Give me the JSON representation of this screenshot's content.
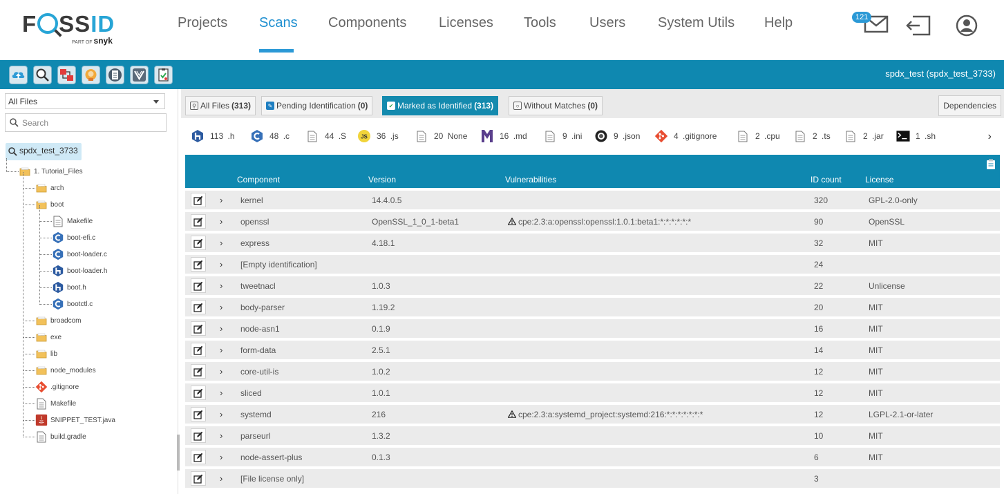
{
  "logo": {
    "word_prefix": "F",
    "word_mid": "SS",
    "word_id": "ID",
    "sub_prefix": "PART OF",
    "sub_brand": "snyk"
  },
  "nav": {
    "items": [
      "Projects",
      "Scans",
      "Components",
      "Licenses",
      "Tools",
      "Users",
      "System Utils",
      "Help"
    ],
    "active": "Scans",
    "mail_badge": "121"
  },
  "toolbar": {
    "scan_title": "spdx_test (spdx_test_3733)",
    "buttons": [
      "upload-icon",
      "search-icon",
      "compare-icon",
      "brain-icon",
      "clipboard-icon",
      "vs-icon",
      "report-icon"
    ]
  },
  "left": {
    "filter_select": "All Files",
    "search_placeholder": "Search",
    "root_label": "spdx_test_3733",
    "tree": [
      {
        "label": "1. Tutorial_Files",
        "type": "folder"
      },
      {
        "label": "arch",
        "type": "folder"
      },
      {
        "label": "boot",
        "type": "folder"
      },
      {
        "label": "Makefile",
        "type": "file"
      },
      {
        "label": "boot-efi.c",
        "type": "c"
      },
      {
        "label": "boot-loader.c",
        "type": "c"
      },
      {
        "label": "boot-loader.h",
        "type": "h"
      },
      {
        "label": "boot.h",
        "type": "h"
      },
      {
        "label": "bootctl.c",
        "type": "c"
      },
      {
        "label": "broadcom",
        "type": "folder"
      },
      {
        "label": "exe",
        "type": "folder"
      },
      {
        "label": "lib",
        "type": "folder"
      },
      {
        "label": "node_modules",
        "type": "folder"
      },
      {
        "label": ".gitignore",
        "type": "git"
      },
      {
        "label": "Makefile",
        "type": "file"
      },
      {
        "label": "SNIPPET_TEST.java",
        "type": "java"
      },
      {
        "label": "build.gradle",
        "type": "file"
      }
    ]
  },
  "filters": [
    {
      "label": "All Files",
      "count": "(313)"
    },
    {
      "label": "Pending Identification",
      "count": "(0)"
    },
    {
      "label": "Marked as Identified",
      "count": "(313)"
    },
    {
      "label": "Without Matches",
      "count": "(0)"
    }
  ],
  "dependencies_label": "Dependencies",
  "extensions": [
    {
      "count": "113",
      "ext": ".h",
      "icon": "h-icon"
    },
    {
      "count": "48",
      "ext": ".c",
      "icon": "c-icon"
    },
    {
      "count": "44",
      "ext": ".S",
      "icon": "file-icon"
    },
    {
      "count": "36",
      "ext": ".js",
      "icon": "js-icon"
    },
    {
      "count": "20",
      "ext": "None",
      "icon": "file-icon"
    },
    {
      "count": "16",
      "ext": ".md",
      "icon": "md-icon"
    },
    {
      "count": "9",
      "ext": ".ini",
      "icon": "file-icon"
    },
    {
      "count": "9",
      "ext": ".json",
      "icon": "json-icon"
    },
    {
      "count": "4",
      "ext": ".gitignore",
      "icon": "git-icon"
    },
    {
      "count": "2",
      "ext": ".cpu",
      "icon": "file-icon"
    },
    {
      "count": "2",
      "ext": ".ts",
      "icon": "file-icon"
    },
    {
      "count": "2",
      "ext": ".jar",
      "icon": "file-icon"
    },
    {
      "count": "1",
      "ext": ".sh",
      "icon": "terminal-icon"
    }
  ],
  "table": {
    "headers": {
      "component": "Component",
      "version": "Version",
      "vulnerabilities": "Vulnerabilities",
      "id_count": "ID count",
      "license": "License"
    },
    "rows": [
      {
        "component": "kernel",
        "version": "14.4.0.5",
        "vuln": "",
        "id_count": "320",
        "license": "GPL-2.0-only"
      },
      {
        "component": "openssl",
        "version": "OpenSSL_1_0_1-beta1",
        "vuln": "cpe:2.3:a:openssl:openssl:1.0.1:beta1:*:*:*:*:*:*",
        "id_count": "90",
        "license": "OpenSSL"
      },
      {
        "component": "express",
        "version": "4.18.1",
        "vuln": "",
        "id_count": "32",
        "license": "MIT"
      },
      {
        "component": "[Empty identification]",
        "version": "",
        "vuln": "",
        "id_count": "24",
        "license": ""
      },
      {
        "component": "tweetnacl",
        "version": "1.0.3",
        "vuln": "",
        "id_count": "22",
        "license": "Unlicense"
      },
      {
        "component": "body-parser",
        "version": "1.19.2",
        "vuln": "",
        "id_count": "20",
        "license": "MIT"
      },
      {
        "component": "node-asn1",
        "version": "0.1.9",
        "vuln": "",
        "id_count": "16",
        "license": "MIT"
      },
      {
        "component": "form-data",
        "version": "2.5.1",
        "vuln": "",
        "id_count": "14",
        "license": "MIT"
      },
      {
        "component": "core-util-is",
        "version": "1.0.2",
        "vuln": "",
        "id_count": "12",
        "license": "MIT"
      },
      {
        "component": "sliced",
        "version": "1.0.1",
        "vuln": "",
        "id_count": "12",
        "license": "MIT"
      },
      {
        "component": "systemd",
        "version": "216",
        "vuln": "cpe:2.3:a:systemd_project:systemd:216:*:*:*:*:*:*:*",
        "id_count": "12",
        "license": "LGPL-2.1-or-later"
      },
      {
        "component": "parseurl",
        "version": "1.3.2",
        "vuln": "",
        "id_count": "10",
        "license": "MIT"
      },
      {
        "component": "node-assert-plus",
        "version": "0.1.3",
        "vuln": "",
        "id_count": "6",
        "license": "MIT"
      },
      {
        "component": "[File license only]",
        "version": "",
        "vuln": "",
        "id_count": "3",
        "license": ""
      }
    ]
  },
  "colors": {
    "accent": "#0f88b0",
    "nav_active": "#1e8fd0",
    "row_bg": "#ebebeb"
  }
}
